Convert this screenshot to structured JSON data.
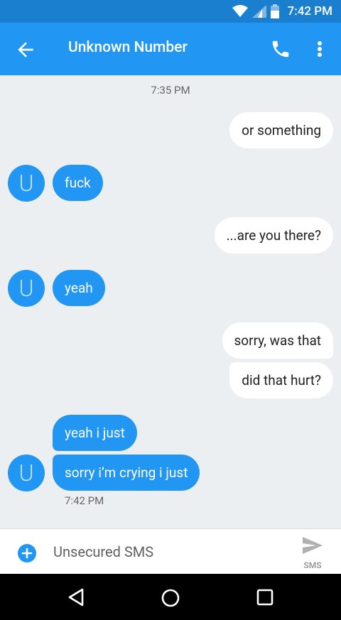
{
  "status": {
    "time": "7:42 PM"
  },
  "header": {
    "title": "Unknown Number"
  },
  "conversation": {
    "timestamp_top": "7:35 PM",
    "messages": [
      {
        "dir": "out",
        "text": "or something"
      },
      {
        "dir": "in",
        "text": "fuck",
        "avatar": "U"
      },
      {
        "dir": "out",
        "text": "...are you there?"
      },
      {
        "dir": "in",
        "text": "yeah",
        "avatar": "U"
      },
      {
        "dir": "out",
        "text": "sorry, was that"
      },
      {
        "dir": "out",
        "text": "did that hurt?"
      },
      {
        "dir": "in",
        "text": "yeah i just"
      },
      {
        "dir": "in",
        "text": "sorry i’m crying i just",
        "avatar": "U"
      }
    ],
    "timestamp_bottom": "7:42 PM"
  },
  "compose": {
    "placeholder": "Unsecured SMS",
    "send_label": "SMS"
  },
  "colors": {
    "status_bar": "#1a7fcf",
    "app_bar": "#2196f3",
    "incoming_bubble": "#2196f3",
    "outgoing_bubble": "#ffffff",
    "background": "#eceff1"
  }
}
